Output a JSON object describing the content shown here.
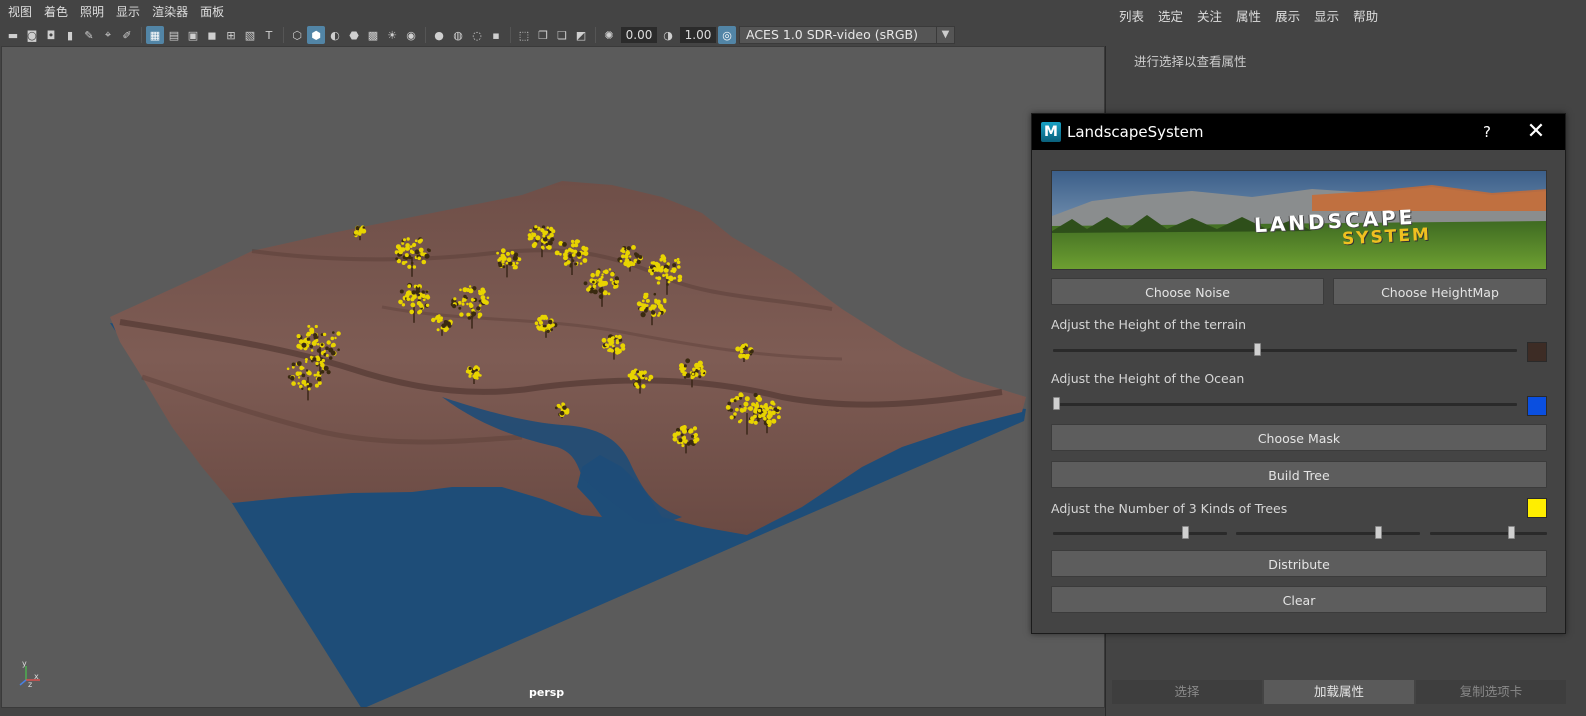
{
  "viewport": {
    "menu": [
      "视图",
      "着色",
      "照明",
      "显示",
      "渲染器",
      "面板"
    ],
    "exposure": "0.00",
    "gamma": "1.00",
    "colorspace": "ACES 1.0 SDR-video (sRGB)",
    "camera_label": "persp",
    "axis_labels": {
      "x": "x",
      "y": "y",
      "z": "z"
    }
  },
  "attribute_editor": {
    "menu": [
      "列表",
      "选定",
      "关注",
      "属性",
      "展示",
      "显示",
      "帮助"
    ],
    "hint": "进行选择以查看属性",
    "tabs": [
      "选择",
      "加载属性",
      "复制选项卡"
    ]
  },
  "dialog": {
    "title": "LandscapeSystem",
    "help": "?",
    "close": "✕",
    "banner_line1": "LANDSCAPE",
    "banner_line2": "SYSTEM",
    "choose_noise": "Choose Noise",
    "choose_heightmap": "Choose HeightMap",
    "terrain_label": "Adjust the Height of the terrain",
    "terrain_value": 0.44,
    "terrain_color": "#3d2c25",
    "ocean_label": "Adjust the Height of the Ocean",
    "ocean_value": 0.0,
    "ocean_color": "#0a4fe0",
    "choose_mask": "Choose Mask",
    "build_tree": "Build Tree",
    "trees_label": "Adjust the Number of 3 Kinds of Trees",
    "tree_color": "#ffee00",
    "tree_values": [
      0.78,
      0.79,
      0.72
    ],
    "distribute": "Distribute",
    "clear": "Clear"
  },
  "colors": {
    "terrain": "#7d5a52",
    "water": "#1e4d78",
    "tree": "#e8d400",
    "accent": "#5285a6"
  }
}
